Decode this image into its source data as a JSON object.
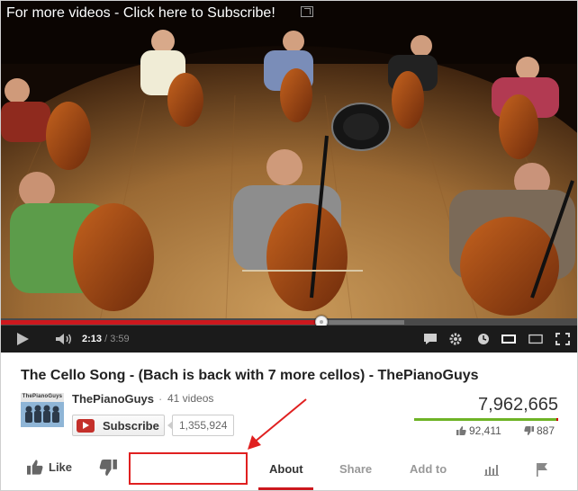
{
  "video": {
    "overlay_title": "For more videos - Click here to Subscribe!",
    "current_time": "2:13",
    "separator": "/",
    "duration": "3:59",
    "progress_fraction": 0.556,
    "buffered_fraction": 0.7
  },
  "info": {
    "title": "The Cello Song - (Bach is back with 7 more cellos) - ThePianoGuys",
    "channel_thumb_brand": "ThePianoGuys",
    "channel_name": "ThePianoGuys",
    "channel_separator": "·",
    "video_count": "41 videos",
    "subscribe_label": "Subscribe",
    "subscriber_count": "1,355,924",
    "views": "7,962,665",
    "likes": "92,411",
    "dislikes": "887",
    "like_fraction": 0.99
  },
  "actions": {
    "like_label": "Like",
    "tabs": [
      "About",
      "Share",
      "Add to"
    ]
  },
  "colors": {
    "accent_red": "#cc181e",
    "like_green": "#6eb326",
    "annotation_red": "#e02020"
  },
  "icons": [
    "play-icon",
    "volume-icon",
    "captions-icon",
    "settings-icon",
    "watch-later-icon",
    "small-player-icon",
    "large-player-icon",
    "fullscreen-icon",
    "youtube-icon",
    "thumbs-up-icon",
    "thumbs-down-icon",
    "stats-icon",
    "flag-icon",
    "popout-icon"
  ]
}
